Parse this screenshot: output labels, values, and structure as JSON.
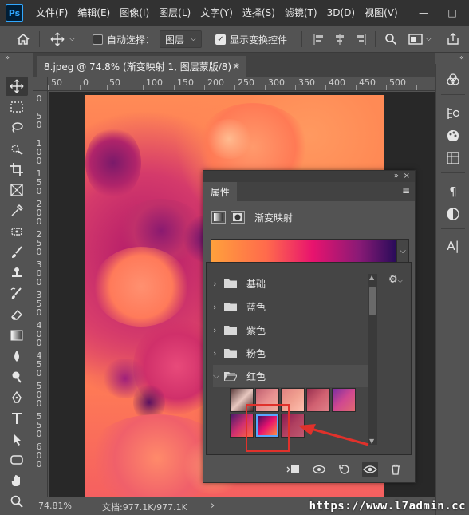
{
  "menubar": {
    "logo": "Ps",
    "items": [
      "文件(F)",
      "编辑(E)",
      "图像(I)",
      "图层(L)",
      "文字(Y)",
      "选择(S)",
      "滤镜(T)",
      "3D(D)",
      "视图(V)"
    ],
    "minimize": "—",
    "maximize": "□"
  },
  "options": {
    "auto_select_label": "自动选择：",
    "auto_select_target": "图层",
    "show_transform_label": "显示变换控件"
  },
  "document": {
    "tab_title": "8.jpeg @ 74.8% (渐变映射 1, 图层蒙版/8) *",
    "close": "×"
  },
  "ruler": {
    "h_labels": [
      "50",
      "0",
      "50",
      "100",
      "150",
      "200",
      "250",
      "300",
      "350",
      "400",
      "450",
      "500"
    ],
    "v_labels": [
      "0",
      "50",
      "100",
      "150",
      "200",
      "250",
      "300",
      "350",
      "400",
      "450",
      "500",
      "550",
      "600"
    ]
  },
  "properties": {
    "tab": "属性",
    "adjustment_name": "渐变映射",
    "collapse": "»",
    "close": "×",
    "menu": "≡"
  },
  "presets": {
    "folders": [
      {
        "name": "基础",
        "expanded": false
      },
      {
        "name": "蓝色",
        "expanded": false
      },
      {
        "name": "紫色",
        "expanded": false
      },
      {
        "name": "粉色",
        "expanded": false
      },
      {
        "name": "红色",
        "expanded": true
      }
    ],
    "swatches_row1": [
      {
        "from": "#5a3a3a",
        "mid": "#e8c8c0",
        "to": "#4a2828"
      },
      {
        "from": "#c06070",
        "mid": "#e89090",
        "to": "#f0b0a0"
      },
      {
        "from": "#e08080",
        "mid": "#f0a090",
        "to": "#ffc0b0"
      },
      {
        "from": "#9a3050",
        "mid": "#d06070",
        "to": "#e08088"
      },
      {
        "from": "#7a2ea0",
        "mid": "#d04890",
        "to": "#e06a70"
      }
    ],
    "swatches_row2": [
      {
        "from": "#4a1a6a",
        "mid": "#d03070",
        "to": "#ff6a40"
      },
      {
        "from": "#2a0c5a",
        "mid": "#e8136e",
        "to": "#ffa03c"
      },
      {
        "from": "#8a1a50",
        "mid": "#b04060",
        "to": "#c05870"
      }
    ]
  },
  "statusbar": {
    "zoom": "74.81%",
    "doc_info": "文档:977.1K/977.1K",
    "arrow": "›"
  },
  "watermark": "https://www.l7admin.cc"
}
